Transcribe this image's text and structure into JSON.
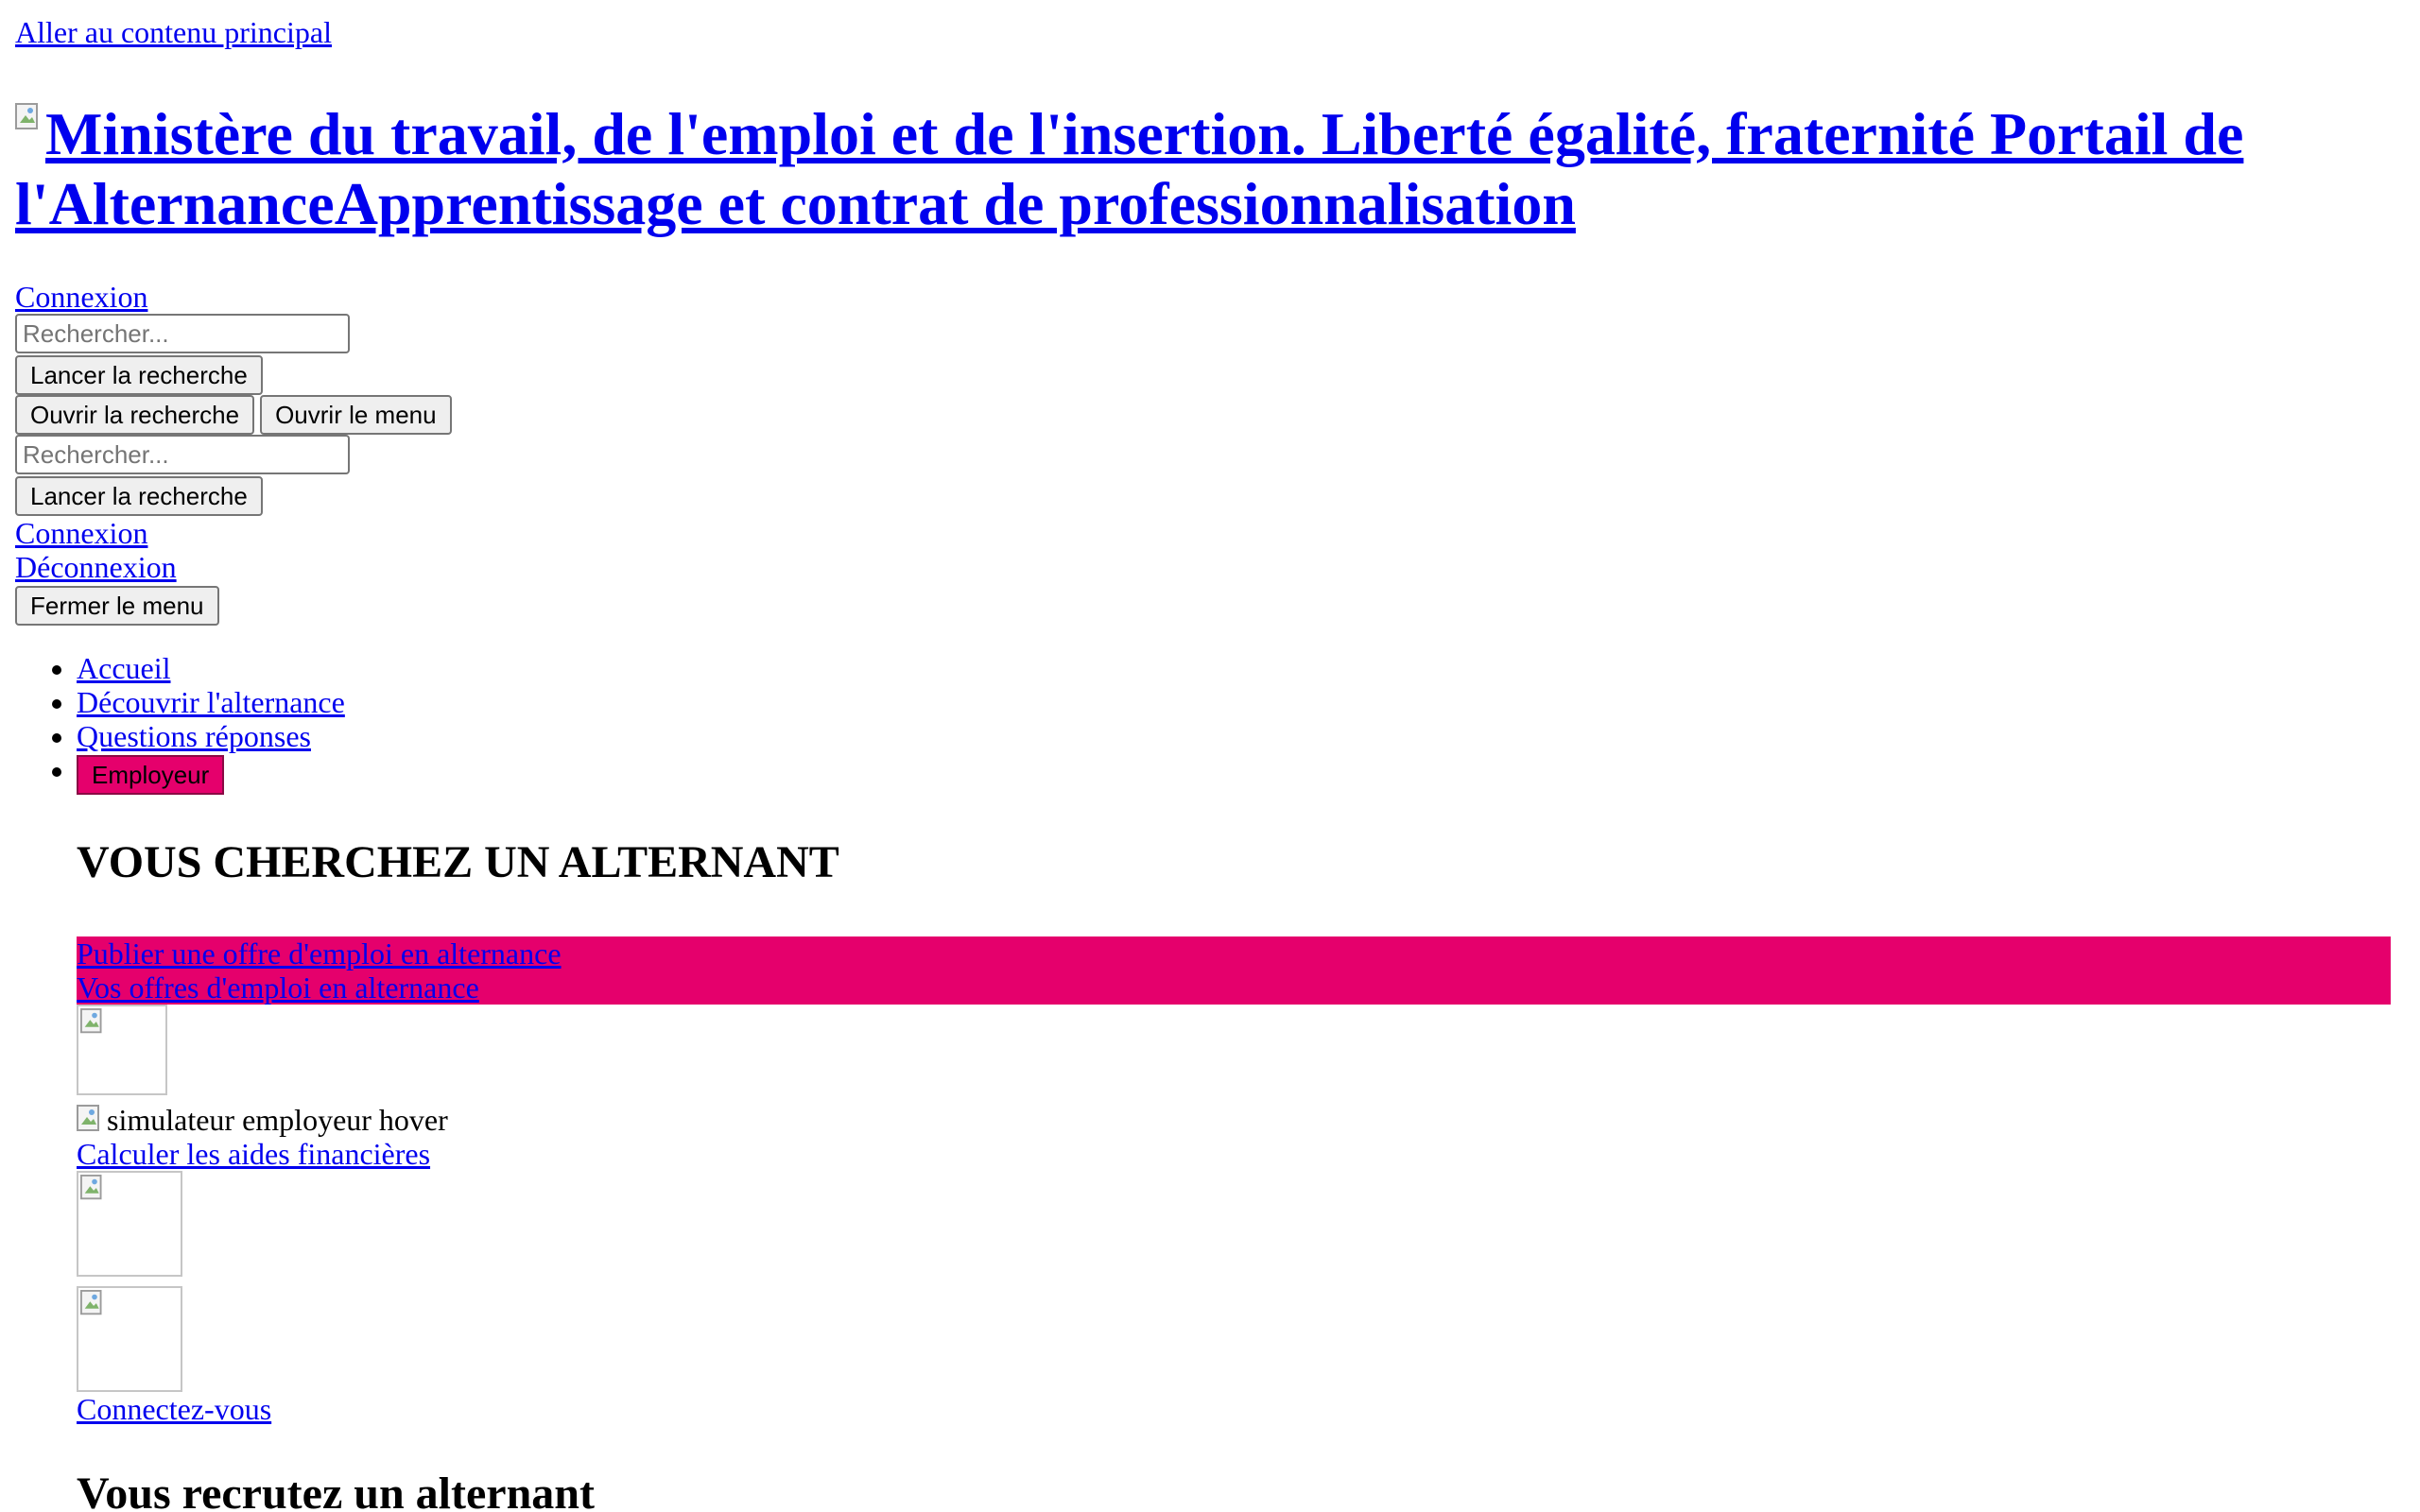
{
  "skip_link": "Aller au contenu principal",
  "header": {
    "logo_alt_title": "Ministère du travail, de l'emploi et de l'insertion. Liberté égalité, fraternité Portail de l'AlternanceApprentissage et contrat de professionnalisation",
    "connexion_link": "Connexion"
  },
  "search": {
    "placeholder": "Rechercher...",
    "submit_label": "Lancer la recherche",
    "open_label": "Ouvrir la recherche"
  },
  "menu": {
    "open_label": "Ouvrir le menu",
    "close_label": "Fermer le menu",
    "connexion_link": "Connexion",
    "deconnexion_link": "Déconnexion"
  },
  "nav": {
    "items": [
      {
        "label": "Accueil"
      },
      {
        "label": "Découvrir l'alternance"
      },
      {
        "label": "Questions réponses"
      }
    ],
    "employeur_button": "Employeur"
  },
  "employer_section": {
    "title": "VOUS CHERCHEZ UN ALTERNANT",
    "links": [
      {
        "label": "Publier une offre d'emploi en alternance"
      },
      {
        "label": "Vos offres d'emploi en alternance"
      }
    ],
    "simulator_alt": "simulateur employeur hover",
    "simulator_link": "Calculer les aides financières",
    "login_link": "Connectez-vous",
    "subtitle": "Vous recrutez un alternant"
  },
  "colors": {
    "accent_pink": "#e5006c",
    "link_blue": "#0000ee"
  },
  "icons": {
    "broken_image": "broken-image-icon"
  }
}
